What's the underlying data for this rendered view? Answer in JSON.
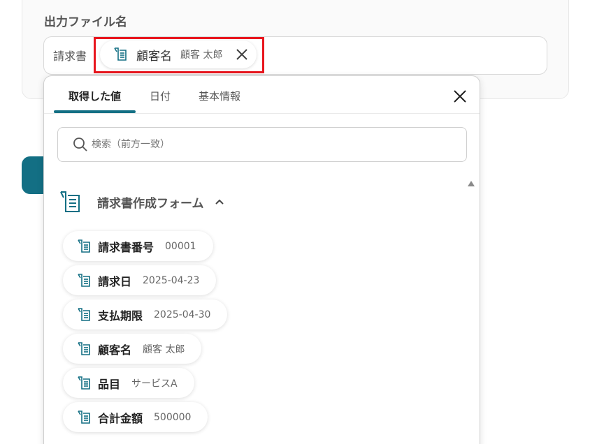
{
  "field": {
    "label": "出力ファイル名",
    "prefix_text": "請求書",
    "selected_chip": {
      "name": "顧客名",
      "value": "顧客 太郎"
    }
  },
  "dropdown": {
    "tabs": [
      {
        "label": "取得した値",
        "active": true
      },
      {
        "label": "日付",
        "active": false
      },
      {
        "label": "基本情報",
        "active": false
      }
    ],
    "search": {
      "placeholder": "検索（前方一致）",
      "value": ""
    },
    "section": {
      "title": "請求書作成フォーム",
      "expanded": true
    },
    "items": [
      {
        "name": "請求書番号",
        "value": "00001"
      },
      {
        "name": "請求日",
        "value": "2025-04-23"
      },
      {
        "name": "支払期限",
        "value": "2025-04-30"
      },
      {
        "name": "顧客名",
        "value": "顧客 太郎"
      },
      {
        "name": "品目",
        "value": "サービスA"
      },
      {
        "name": "合計金額",
        "value": "500000"
      }
    ]
  },
  "colors": {
    "accent": "#136f84",
    "highlight": "#e8161e"
  },
  "icons": {
    "field_icon": "form-field-icon",
    "close": "close-icon",
    "search": "search-icon",
    "section": "form-icon",
    "collapse": "chevron-up-icon",
    "scroll": "scroll-up-arrow"
  }
}
